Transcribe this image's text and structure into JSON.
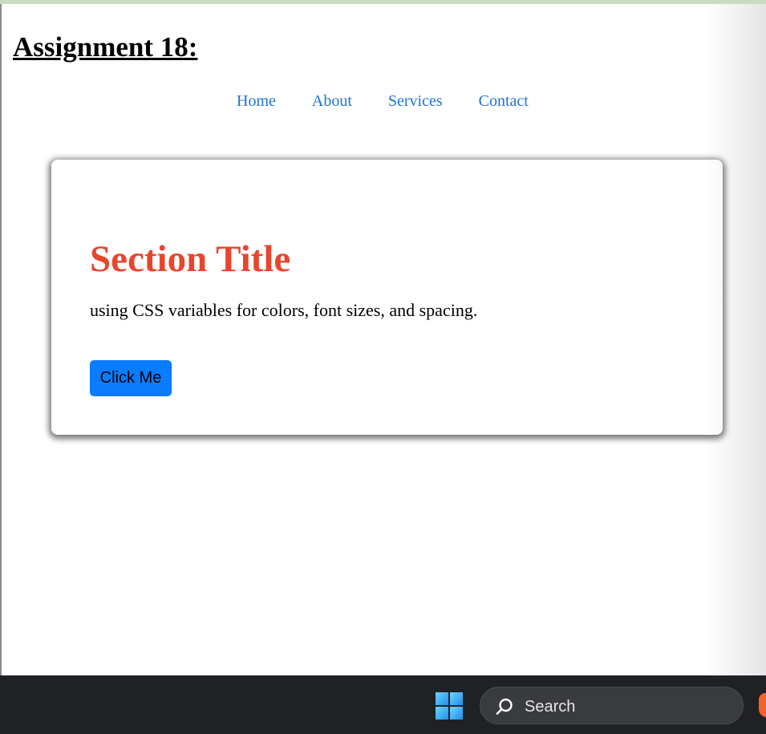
{
  "page": {
    "title": "Assignment 18:",
    "nav": [
      "Home",
      "About",
      "Services",
      "Contact"
    ]
  },
  "card": {
    "title": "Section Title",
    "text": "using CSS variables for colors, font sizes, and spacing.",
    "button_label": "Click Me"
  },
  "taskbar": {
    "search_label": "Search",
    "icons": [
      "windows-start-icon",
      "search-icon",
      "brave-browser-icon"
    ]
  },
  "colors": {
    "section_title": "#e8452f",
    "nav_link": "#1f73d6",
    "button": "#0a7cff",
    "taskbar": "#202124"
  }
}
